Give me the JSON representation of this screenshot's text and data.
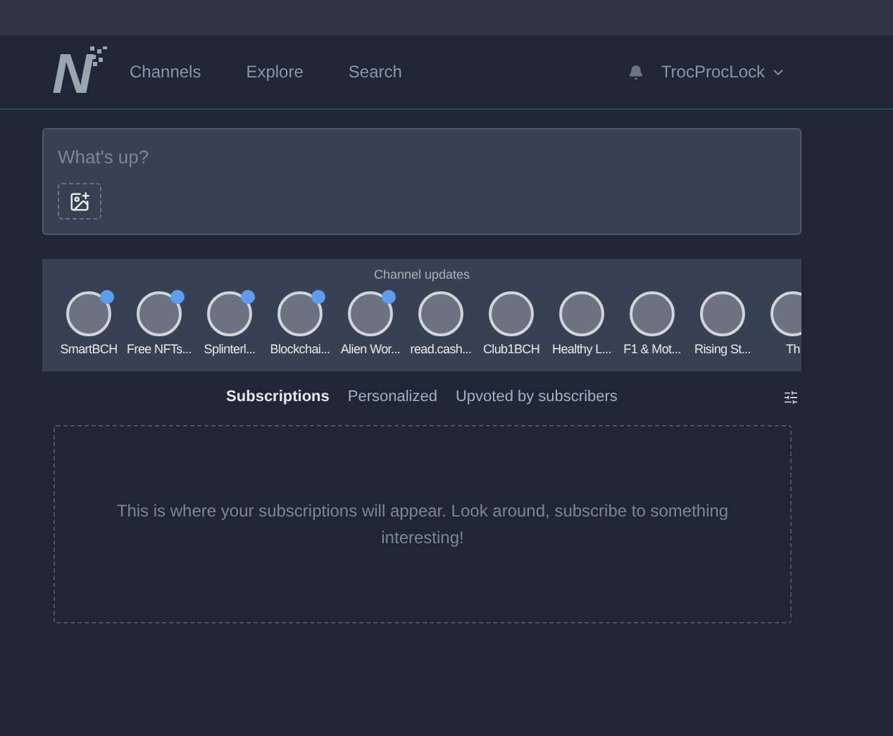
{
  "nav": {
    "logo": "N",
    "links": [
      {
        "label": "Channels"
      },
      {
        "label": "Explore"
      },
      {
        "label": "Search"
      }
    ],
    "user": "TrocProcLock"
  },
  "composer": {
    "placeholder": "What's up?"
  },
  "channel_updates": {
    "title": "Channel updates",
    "channels": [
      {
        "name": "SmartBCH",
        "unread": true
      },
      {
        "name": "Free NFTs...",
        "unread": true
      },
      {
        "name": "Splinterl...",
        "unread": true
      },
      {
        "name": "Blockchai...",
        "unread": true
      },
      {
        "name": "Alien Wor...",
        "unread": true
      },
      {
        "name": "read.cash...",
        "unread": false
      },
      {
        "name": "Club1BCH",
        "unread": false
      },
      {
        "name": "Healthy L...",
        "unread": false
      },
      {
        "name": "F1 & Mot...",
        "unread": false
      },
      {
        "name": "Rising St...",
        "unread": false
      },
      {
        "name": "Th",
        "unread": false
      }
    ]
  },
  "feed_tabs": [
    {
      "label": "Subscriptions",
      "selected": true
    },
    {
      "label": "Personalized",
      "selected": false
    },
    {
      "label": "Upvoted by subscribers",
      "selected": false
    }
  ],
  "empty_message": "This is where your subscriptions will appear. Look around, subscribe to something interesting!"
}
